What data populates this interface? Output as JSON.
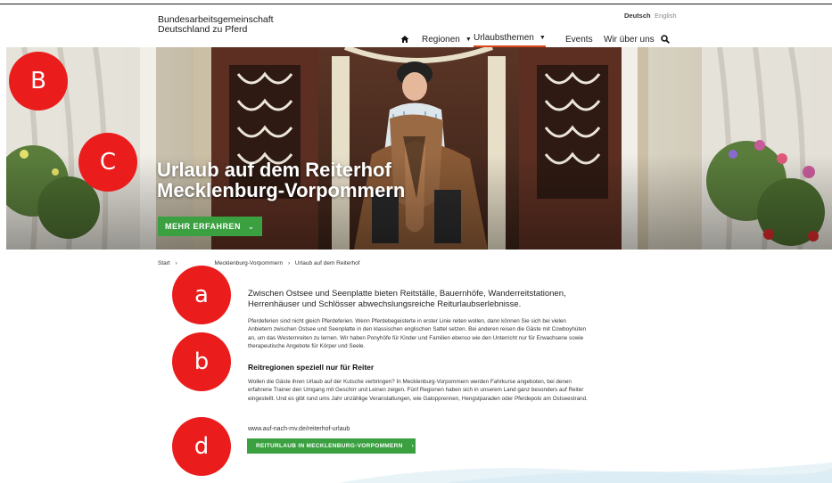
{
  "header": {
    "logo_line1": "Bundesarbeitsgemeinschaft",
    "logo_line2": "Deutschland zu Pferd",
    "lang_active": "Deutsch",
    "lang_other": "English",
    "nav": {
      "home_icon": "home-icon",
      "regionen": "Regionen",
      "urlaubsthemen": "Urlaubsthemen",
      "events": "Events",
      "wir": "Wir über uns",
      "search_icon": "search-icon"
    }
  },
  "hero": {
    "title_line1": "Urlaub auf dem Reiterhof",
    "title_line2": "Mecklenburg-Vorpommern",
    "button": "MEHR ERFAHREN"
  },
  "markers": {
    "B": "B",
    "C": "C",
    "a": "a",
    "b": "b",
    "d": "d"
  },
  "breadcrumb": {
    "start": "Start",
    "region": "Mecklenburg-Vorpommern",
    "current": "Urlaub auf dem Reiterhof"
  },
  "content": {
    "lead": "Zwischen Ostsee und Seenplatte bieten Reitställe, Bauernhöfe, Wanderreitstationen, Herrenhäuser und Schlösser abwechslungsreiche Reiturlaubserlebnisse.",
    "p1": "Pferdeferien sind nicht gleich Pferdeferien. Wenn Pferdebegeisterte in erster Linie reiten wollen, dann können Sie sich bei vielen Anbietern zwischen Ostsee und Seenplatte in den klassischen englischen Sattel setzen. Bei anderen reisen die Gäste mit Cowboyhüten an, um das Westernreiten zu lernen. Wir haben Ponyhöfe für Kinder und Familien ebenso wie den Unterricht nur für Erwachsene sowie therapeutische Angebote für Körper und Seele.",
    "h2": "Reitregionen speziell nur für Reiter",
    "p2": "Wollen die Gäste ihren Urlaub auf der Kutsche verbringen? In Mecklenburg-Vorpommern werden Fahrkurse angeboten, bei denen erfahrene Trainer den Umgang mit Geschirr und Leinen zeigen. Fünf Regionen haben sich in unserem Land ganz besonders auf Reiter eingestellt. Und es gibt rund ums Jahr unzählige Veranstaltungen, wie Galopprennen, Hengstparaden oder Pferdepolo am Ostseestrand.",
    "url": "www.auf-nach-mv.de/reiterhof-urlaub",
    "cta": "REITURLAUB IN MECKLENBURG-VORPOMMERN"
  },
  "colors": {
    "accent_green": "#3aa040",
    "nav_underline": "#d9471a",
    "marker_red": "#ea1c1c"
  }
}
